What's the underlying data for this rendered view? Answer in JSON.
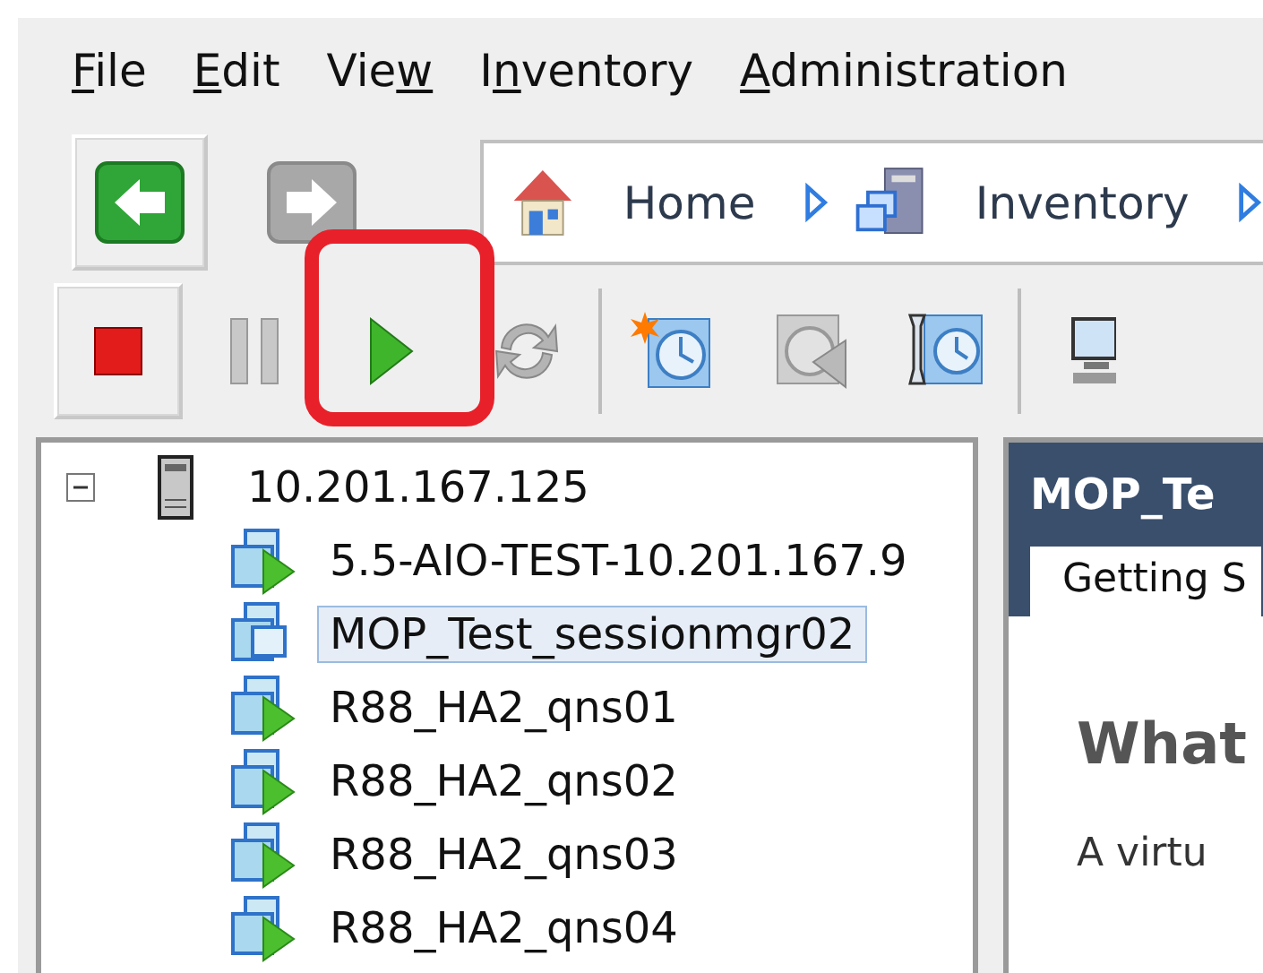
{
  "menu": [
    {
      "key": "F",
      "after": "ile"
    },
    {
      "key": "E",
      "after": "dit"
    },
    {
      "before": "Vie",
      "key": "w"
    },
    {
      "before": "I",
      "key": "n",
      "after": "ventory"
    },
    {
      "key": "A",
      "after": "dministration"
    }
  ],
  "nav": [
    {
      "kind": "back",
      "disabled": false
    },
    {
      "kind": "forward",
      "disabled": true
    }
  ],
  "breadcrumb": [
    {
      "kind": "home",
      "label": "Home"
    },
    {
      "kind": "inventory",
      "label": "Inventory"
    }
  ],
  "toolbar": [
    {
      "kind": "stop",
      "pressed": true,
      "highlighted": false
    },
    {
      "kind": "pause",
      "pressed": false,
      "highlighted": false
    },
    {
      "kind": "play",
      "pressed": false,
      "highlighted": true
    },
    {
      "kind": "reset",
      "pressed": false,
      "highlighted": false
    },
    {
      "kind": "separator"
    },
    {
      "kind": "snapshot-new",
      "pressed": false,
      "highlighted": false
    },
    {
      "kind": "snapshot-revert",
      "pressed": false,
      "highlighted": false
    },
    {
      "kind": "snapshot-manage",
      "pressed": false,
      "highlighted": false
    },
    {
      "kind": "separator"
    },
    {
      "kind": "console",
      "pressed": false,
      "highlighted": false
    }
  ],
  "tree": {
    "label": "10.201.167.125",
    "kind": "host",
    "expanded": true,
    "selected": false,
    "children": [
      {
        "label": "5.5-AIO-TEST-10.201.167.9",
        "kind": "vm-on",
        "selected": false
      },
      {
        "label": "MOP_Test_sessionmgr02",
        "kind": "vm-off",
        "selected": true
      },
      {
        "label": "R88_HA2_qns01",
        "kind": "vm-on",
        "selected": false
      },
      {
        "label": "R88_HA2_qns02",
        "kind": "vm-on",
        "selected": false
      },
      {
        "label": "R88_HA2_qns03",
        "kind": "vm-on",
        "selected": false
      },
      {
        "label": "R88_HA2_qns04",
        "kind": "vm-on",
        "selected": false
      }
    ]
  },
  "detail": {
    "title": "MOP_Te",
    "tabs": [
      {
        "label": "Getting S",
        "selected": true
      }
    ],
    "heading": "What",
    "text": "A virtu"
  }
}
